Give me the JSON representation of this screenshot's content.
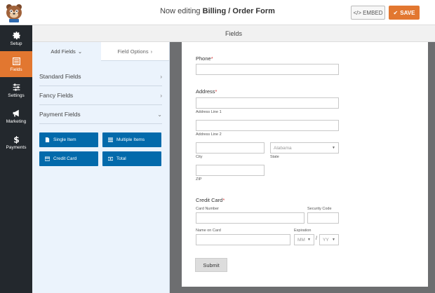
{
  "header": {
    "editing_prefix": "Now editing",
    "form_name": "Billing / Order Form",
    "embed_label": "EMBED",
    "save_label": "SAVE"
  },
  "nav": {
    "items": [
      {
        "label": "Setup",
        "icon": "gear-icon"
      },
      {
        "label": "Fields",
        "icon": "fields-icon"
      },
      {
        "label": "Settings",
        "icon": "sliders-icon"
      },
      {
        "label": "Marketing",
        "icon": "megaphone-icon"
      },
      {
        "label": "Payments",
        "icon": "dollar-icon"
      }
    ]
  },
  "fields_bar": {
    "title": "Fields"
  },
  "panel": {
    "tab_add": "Add Fields",
    "tab_options": "Field Options",
    "sections": [
      "Standard Fields",
      "Fancy Fields",
      "Payment Fields"
    ],
    "payment_buttons": [
      "Single Item",
      "Multiple Items",
      "Credit Card",
      "Total"
    ]
  },
  "form": {
    "phone_label": "Phone",
    "address_label": "Address",
    "address_line1": "Address Line 1",
    "address_line2": "Address Line 2",
    "state_value": "Alabama",
    "city": "City",
    "state": "State",
    "zip": "ZIP",
    "credit_card_label": "Credit Card",
    "card_number": "Card Number",
    "security_code": "Security Code",
    "name_on_card": "Name on Card",
    "expiration": "Expiration",
    "month_placeholder": "MM",
    "year_placeholder": "YY",
    "slash": "/",
    "required_mark": "*",
    "submit_label": "Submit"
  },
  "colors": {
    "accent": "#e27730",
    "sidebar": "#23282d",
    "field_button": "#036aab",
    "panel_bg": "#ebf3fc"
  }
}
